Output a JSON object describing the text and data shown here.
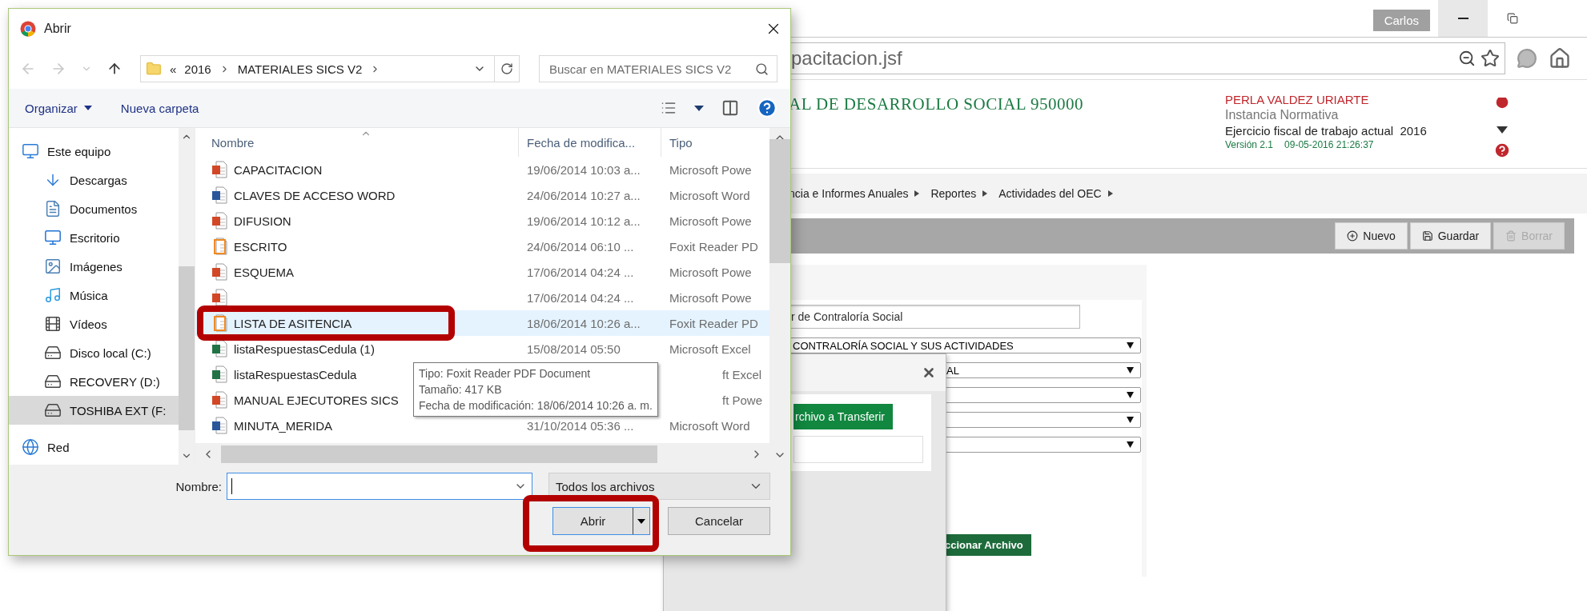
{
  "browser": {
    "user": "Carlos",
    "address": "pacitacion.jsf"
  },
  "page": {
    "org_title": "AL DE DESARROLLO SOCIAL 950000",
    "user_name": "PERLA VALDEZ URIARTE",
    "role": "Instancia Normativa",
    "fiscal_year": "Ejercicio fiscal de trabajo actual  2016",
    "version": "Versión 2.1",
    "timestamp": "09-05-2016 21:26:37"
  },
  "menu": [
    "ncia e Informes Anuales",
    "Reportes",
    "Actividades del OEC"
  ],
  "actions": [
    {
      "label": "Nuevo",
      "kind": "new",
      "disabled": false
    },
    {
      "label": "Guardar",
      "kind": "save",
      "disabled": false
    },
    {
      "label": "Borrar",
      "kind": "delete",
      "disabled": true
    }
  ],
  "form": {
    "text_field": "r de Contraloría Social",
    "selects": [
      {
        "value": "CONTRALORÍA SOCIAL Y SUS ACTIVIDADES"
      },
      {
        "value": "AL"
      },
      {
        "kind": "blank"
      },
      {
        "kind": "blank"
      },
      {
        "kind": "blank"
      }
    ],
    "button": "ccionar Archivo"
  },
  "upload_modal": {
    "button": "rchivo a Transferir"
  },
  "file_dialog": {
    "title": "Abrir",
    "breadcrumb": {
      "overflow": "«",
      "parts": [
        "2016",
        "MATERIALES SICS V2"
      ]
    },
    "search": {
      "placeholder": "Buscar en MATERIALES SICS V2"
    },
    "toolbar": [
      "Organizar",
      "Nueva carpeta"
    ],
    "nav_items": [
      {
        "label": "Este equipo",
        "kind": "pc",
        "selected": false,
        "children": [
          {
            "label": "Descargas",
            "kind": "downloads",
            "selected": false
          },
          {
            "label": "Documentos",
            "kind": "documents",
            "selected": false
          },
          {
            "label": "Escritorio",
            "kind": "desktop",
            "selected": false
          },
          {
            "label": "Imágenes",
            "kind": "images",
            "selected": false
          },
          {
            "label": "Música",
            "kind": "music",
            "selected": false
          },
          {
            "label": "Vídeos",
            "kind": "videos",
            "selected": false
          },
          {
            "label": "Disco local (C:)",
            "kind": "system_disk",
            "selected": false
          },
          {
            "label": "RECOVERY (D:)",
            "kind": "disk",
            "selected": false
          },
          {
            "label": "TOSHIBA EXT (F:",
            "kind": "disk",
            "selected": true
          }
        ]
      },
      {
        "label": "Red",
        "kind": "network",
        "selected": false
      }
    ],
    "columns": [
      "Nombre",
      "Fecha de modifica...",
      "Tipo"
    ],
    "rows": [
      {
        "name": "CAPACITACION",
        "kind": "ppt",
        "date": "19/06/2014 10:03 a...",
        "type": "Microsoft Powe",
        "selected": false,
        "highlighted": false
      },
      {
        "name": "CLAVES DE ACCESO WORD",
        "kind": "word",
        "date": "24/06/2014 10:27 a...",
        "type": "Microsoft Word",
        "selected": false,
        "highlighted": false
      },
      {
        "name": "DIFUSION",
        "kind": "ppt",
        "date": "19/06/2014 10:12 a...",
        "type": "Microsoft Powe",
        "selected": false,
        "highlighted": false
      },
      {
        "name": "ESCRITO",
        "kind": "pdf",
        "date": "24/06/2014 06:10 ...",
        "type": "Foxit Reader PD",
        "selected": false,
        "highlighted": false
      },
      {
        "name": "ESQUEMA",
        "kind": "ppt",
        "date": "17/06/2014 04:24 ...",
        "type": "Microsoft Powe",
        "selected": false,
        "highlighted": false
      },
      {
        "kind": "ppt",
        "date": "17/06/2014 04:24 ...",
        "type": "Microsoft Powe",
        "selected": false,
        "highlighted": false
      },
      {
        "name": "LISTA DE ASITENCIA",
        "kind": "pdf",
        "date": "18/06/2014 10:26 a...",
        "type": "Foxit Reader PD",
        "selected": true,
        "highlighted": true
      },
      {
        "name": "listaRespuestasCedula (1)",
        "kind": "excel",
        "date": "15/08/2014 05:50",
        "type": "Microsoft Excel",
        "selected": false,
        "highlighted": false
      },
      {
        "name": "listaRespuestasCedula",
        "kind": "excel",
        "type": "ft Excel",
        "selected": false,
        "highlighted": false
      },
      {
        "name": "MANUAL EJECUTORES SICS",
        "kind": "ppt",
        "type": "ft Powe",
        "selected": false,
        "highlighted": false
      },
      {
        "name": "MINUTA_MERIDA",
        "kind": "word",
        "date": "31/10/2014 05:36 ...",
        "type": "Microsoft Word",
        "selected": false,
        "highlighted": false
      }
    ],
    "tooltip": [
      "Tipo: Foxit Reader PDF Document",
      "Tamaño: 417 KB",
      "Fecha de modificación: 18/06/2014 10:26 a. m."
    ],
    "filename_label": "Nombre:",
    "filter": "Todos los archivos",
    "buttons": [
      {
        "label": "Abrir",
        "kind": "split",
        "highlighted": true
      },
      {
        "label": "Cancelar",
        "kind": "plain",
        "highlighted": false
      }
    ]
  }
}
